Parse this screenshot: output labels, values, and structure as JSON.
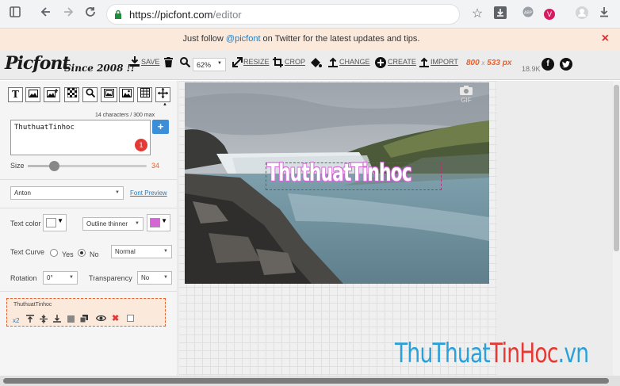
{
  "browser": {
    "url": "https://picfont.com/editor",
    "url_host": "https://picfont.com",
    "url_path": "/editor",
    "profile_initial": "V",
    "icons": [
      "sidebar-toggle-icon",
      "back-icon",
      "forward-icon",
      "reload-icon",
      "lock-icon",
      "star-icon",
      "download-box-icon",
      "adblock-icon",
      "profile-icon",
      "account-icon",
      "download-icon"
    ]
  },
  "notice": {
    "text_before": "Just follow ",
    "link": "@picfont",
    "text_after": " on Twitter for the latest updates and tips.",
    "close": "×"
  },
  "toolbar": {
    "logo": "Picfont",
    "since": "Since 2008 !!",
    "save": "SAVE",
    "zoom": "62%",
    "resize": "RESIZE",
    "crop": "CROP",
    "change": "CHANGE",
    "create": "CREATE",
    "import": "IMPORT",
    "width": "800",
    "x": "x",
    "height": "533",
    "unit": "px",
    "followers": "18.9K",
    "accent": "#e8612c"
  },
  "panel": {
    "tools": [
      "text-tool-icon",
      "image-tool-icon",
      "add-image-icon",
      "pattern-icon",
      "search-icon",
      "frame-icon",
      "grid-icon",
      "move-icon"
    ],
    "chars": "14 characters / 300 max",
    "text_value": "ThuthuatTinhoc",
    "add": "+",
    "badge": "1",
    "size_label": "Size",
    "size_value": "34",
    "size_fraction": 0.22,
    "font": "Anton",
    "font_preview": "Font Preview",
    "text_color_label": "Text color",
    "text_color": "#ffffff",
    "outline": "Outline thinner",
    "outline_color": "#d566d6",
    "curve_label": "Text Curve",
    "curve_yes": "Yes",
    "curve_no": "No",
    "curve_mode": "Normal",
    "rotation_label": "Rotation",
    "rotation": "0°",
    "transparency_label": "Transparency",
    "transparency": "No",
    "layer_name": "ThuthuatTinhoc",
    "layer_x2": "x2",
    "sort_arrow": "▲"
  },
  "canvas": {
    "overlay_text": "ThuthuatTinhoc",
    "gif_label": "GIF"
  },
  "watermark": {
    "part1": "ThuThuat",
    "part2": "TinHoc",
    "part3": ".vn"
  }
}
